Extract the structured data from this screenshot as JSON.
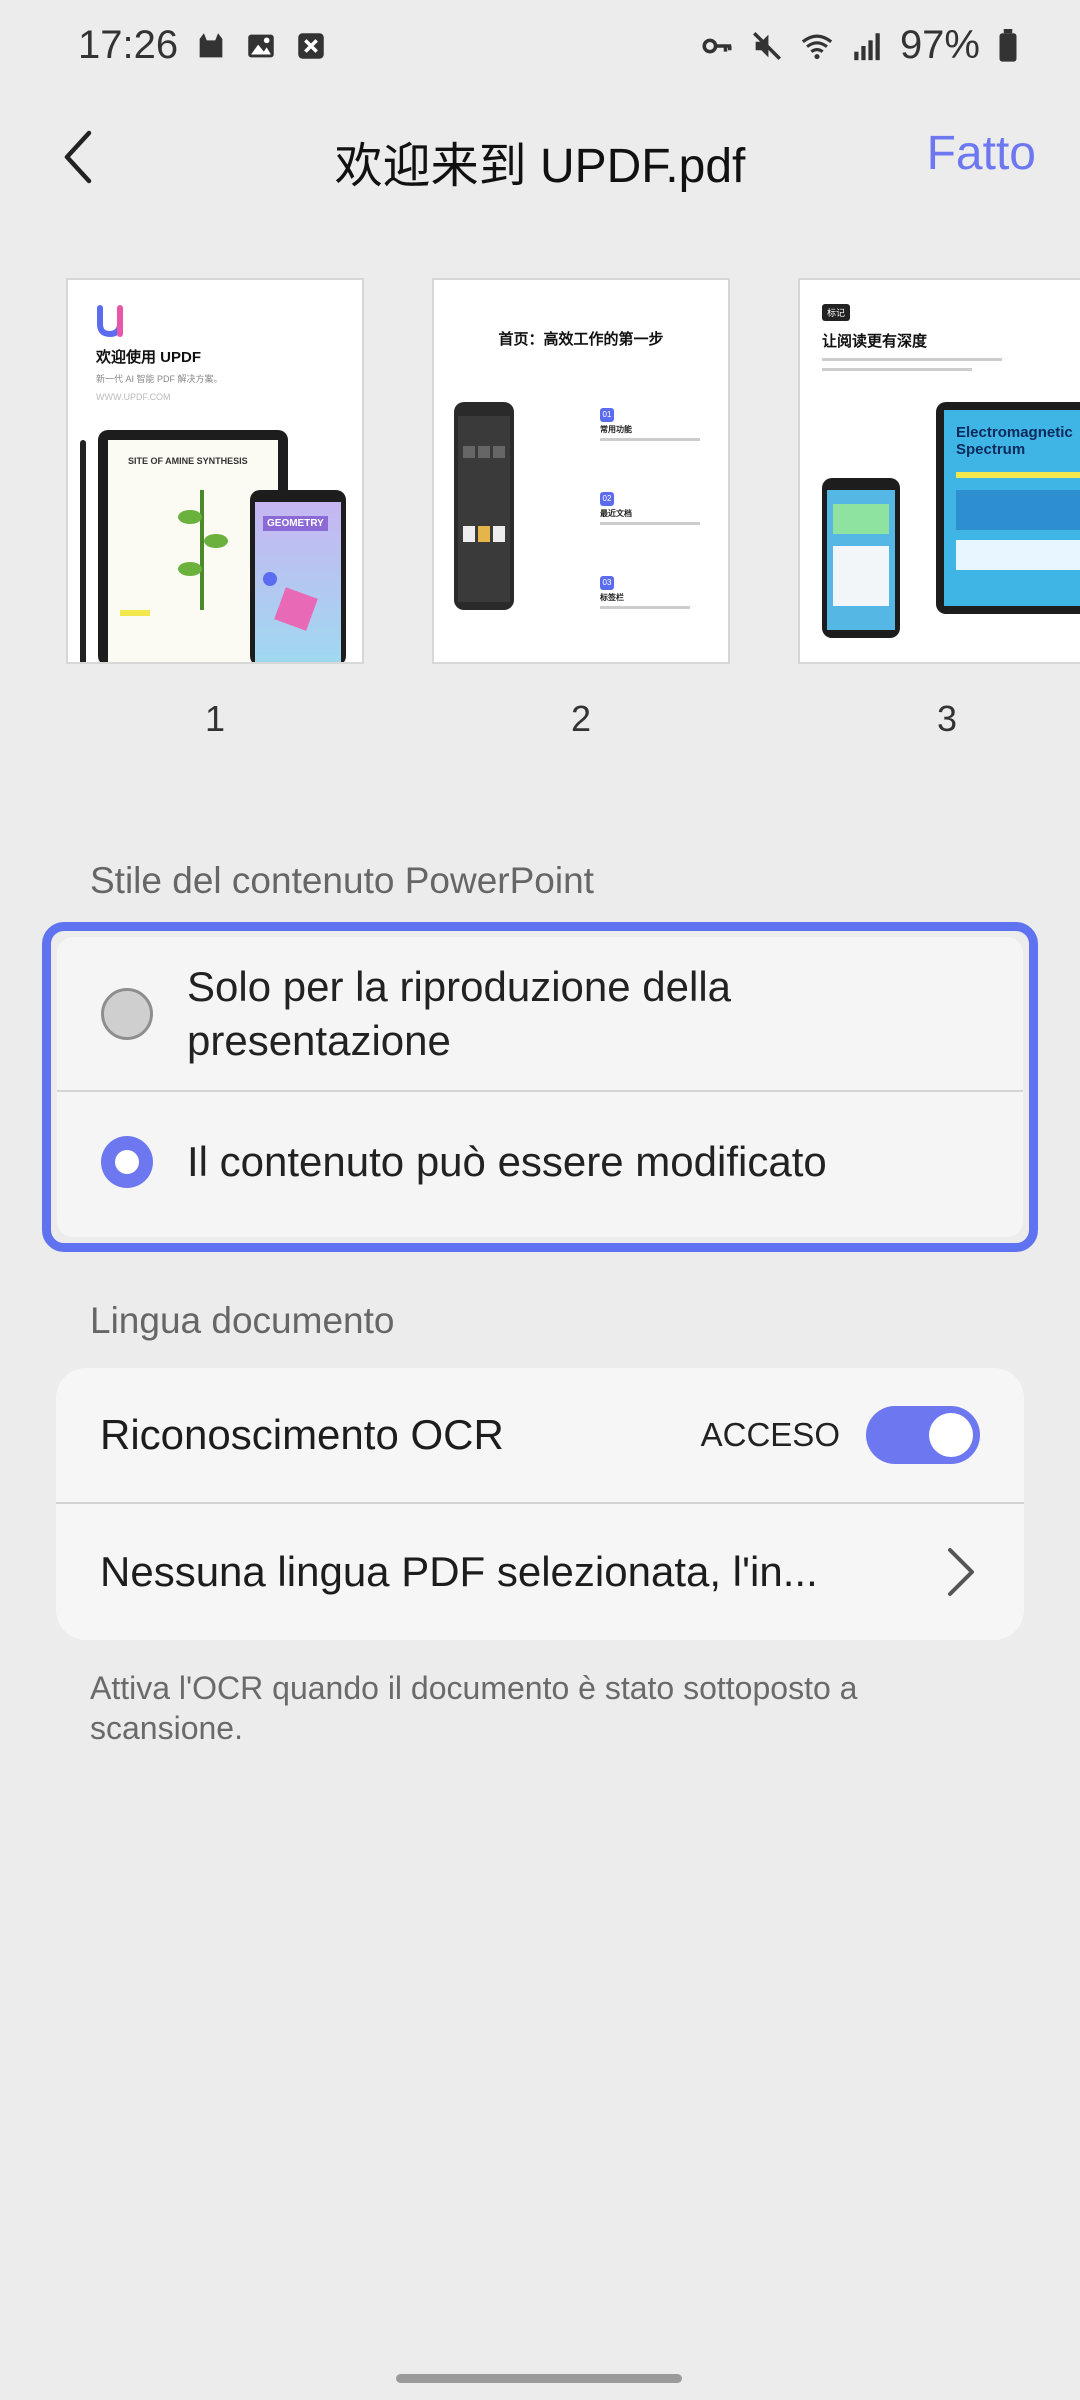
{
  "status_bar": {
    "time": "17:26",
    "battery": "97%",
    "icons_left": [
      "cat-icon",
      "image-icon",
      "close-box-icon"
    ],
    "icons_right": [
      "key-icon",
      "mute-icon",
      "wifi-icon",
      "signal-icon",
      "battery-icon"
    ]
  },
  "header": {
    "title": "欢迎来到 UPDF.pdf",
    "done_label": "Fatto"
  },
  "thumbnails": [
    {
      "number": "1",
      "heading": "欢迎使用 UPDF",
      "subheading": "新一代 AI 智能 PDF 解决方案。",
      "url": "WWW.UPDF.COM",
      "art_1": "SITE OF AMINE SYNTHESIS",
      "art_2": "GEOMETRY"
    },
    {
      "number": "2",
      "heading": "首页：高效工作的第一步",
      "step_1": "01",
      "step_1_label": "常用功能",
      "step_2": "02",
      "step_2_label": "最近文档",
      "step_3": "03",
      "step_3_label": "标签栏"
    },
    {
      "number": "3",
      "badge": "标记",
      "heading": "让阅读更有深度",
      "art_1": "Electromagnetic Spectrum"
    }
  ],
  "style_section": {
    "label": "Stile del contenuto PowerPoint",
    "options": [
      {
        "label": "Solo per la riproduzione della presentazione",
        "selected": false
      },
      {
        "label": "Il contenuto può essere modificato",
        "selected": true
      }
    ]
  },
  "language_section": {
    "label": "Lingua documento",
    "ocr_label": "Riconoscimento OCR",
    "ocr_state": "ACCESO",
    "ocr_enabled": true,
    "language_text": "Nessuna lingua PDF selezionata, l'in...",
    "hint": "Attiva l'OCR quando il documento è stato sottoposto a scansione."
  },
  "colors": {
    "accent": "#6d78f0",
    "focus_border": "#5f72f0",
    "background": "#ececec"
  }
}
